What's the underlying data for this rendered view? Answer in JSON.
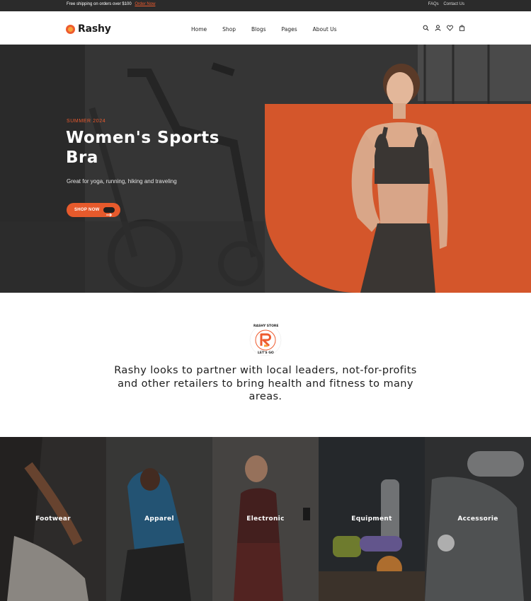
{
  "topbar": {
    "promo_text": "Free shipping on orders over $100",
    "promo_link": "Order Now",
    "links": [
      "FAQs",
      "Contact Us"
    ]
  },
  "header": {
    "brand": "Rashy",
    "nav": [
      "Home",
      "Shop",
      "Blogs",
      "Pages",
      "About Us"
    ],
    "icons": [
      "search-icon",
      "user-icon",
      "heart-icon",
      "cart-icon"
    ]
  },
  "hero": {
    "eyebrow": "SUMMER 2024",
    "title": "Women's Sports Bra",
    "subtitle": "Great for yoga, running, hiking and traveling",
    "button_label": "SHOP NOW"
  },
  "about": {
    "badge_top": "RASHY STORE",
    "badge_bottom": "LET'S GO",
    "text": "Rashy looks to partner with local leaders, not-for-profits and other retailers to bring health and fitness to many areas."
  },
  "categories": [
    {
      "label": "Footwear"
    },
    {
      "label": "Apparel"
    },
    {
      "label": "Electronic"
    },
    {
      "label": "Equipment"
    },
    {
      "label": "Accessorie"
    }
  ],
  "colors": {
    "accent": "#ee5b2e",
    "topbar_bg": "#2b2b2b",
    "hero_bg": "#3a3a3a",
    "hero_panel": "#d4562b"
  }
}
